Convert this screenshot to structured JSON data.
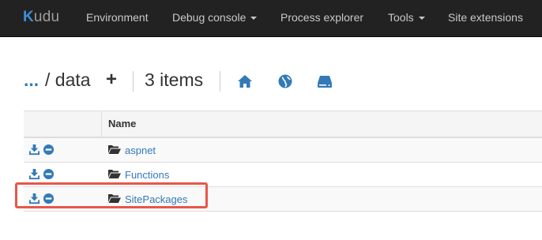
{
  "navbar": {
    "brand_first": "K",
    "brand_rest": "udu",
    "items": [
      {
        "label": "Environment",
        "dropdown": false
      },
      {
        "label": "Debug console",
        "dropdown": true
      },
      {
        "label": "Process explorer",
        "dropdown": false
      },
      {
        "label": "Tools",
        "dropdown": true
      },
      {
        "label": "Site extensions",
        "dropdown": false
      }
    ]
  },
  "header": {
    "ellipsis": "...",
    "path": " / data",
    "add_symbol": "+",
    "item_count": "3 items",
    "icons": [
      "home-icon",
      "globe-icon",
      "hard-drive-icon"
    ]
  },
  "table": {
    "column_name": "Name",
    "rows": [
      {
        "name": "aspnet",
        "type": "folder"
      },
      {
        "name": "Functions",
        "type": "folder"
      },
      {
        "name": "SitePackages",
        "type": "folder",
        "highlighted": true
      }
    ]
  },
  "colors": {
    "navbar_bg": "#222222",
    "link": "#337ab7",
    "highlight": "#e8574a"
  }
}
